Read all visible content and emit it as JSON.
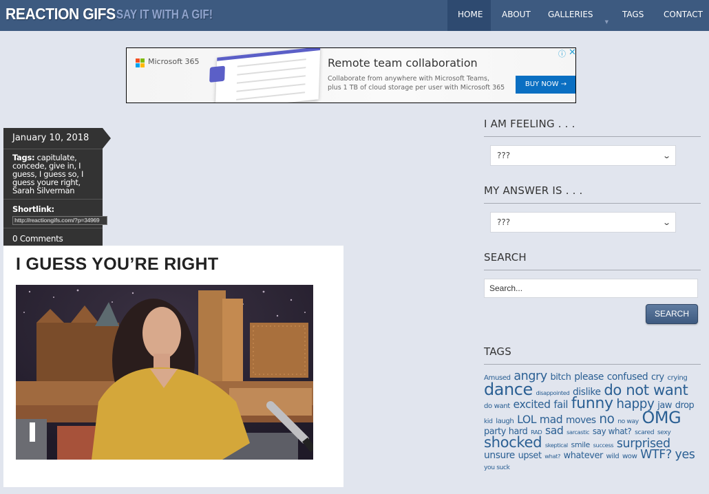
{
  "header": {
    "logo": "REACTION GIFS",
    "tagline": "SAY IT WITH A GIF!",
    "nav": [
      {
        "label": "HOME",
        "active": true
      },
      {
        "label": "ABOUT"
      },
      {
        "label": "GALLERIES",
        "has_dropdown": true
      },
      {
        "label": "TAGS"
      },
      {
        "label": "CONTACT"
      }
    ],
    "colors": {
      "bar": "#3d5a80",
      "active": "#2e4a70"
    }
  },
  "ad": {
    "brand": "Microsoft 365",
    "title": "Remote team collaboration",
    "desc_line1": "Collaborate from anywhere with Microsoft Teams,",
    "desc_line2": "plus 1 TB of cloud storage per user with Microsoft 365",
    "button": "BUY NOW →",
    "info_icon": "ⓘ",
    "close_icon": "✕"
  },
  "post": {
    "date": "January 10, 2018",
    "tags_label": "Tags:",
    "tags": "capitulate, concede, give in, I guess, I guess so, I guess youre right, Sarah Silverman",
    "shortlink_label": "Shortlink:",
    "shortlink": "http://reactiongifs.com/?p=34969",
    "comments": "0 Comments",
    "title": "I GUESS YOU’RE RIGHT"
  },
  "sidebar": {
    "feeling": {
      "heading": "I AM FEELING . . .",
      "selected": "???"
    },
    "answer": {
      "heading": "MY ANSWER IS . . .",
      "selected": "???"
    },
    "search": {
      "heading": "SEARCH",
      "placeholder": "Search...",
      "button": "SEARCH"
    },
    "tags": {
      "heading": "TAGS",
      "cloud": [
        {
          "t": "Amused",
          "s": 11
        },
        {
          "t": "angry",
          "s": 19
        },
        {
          "t": "bitch",
          "s": 14
        },
        {
          "t": "please",
          "s": 15
        },
        {
          "t": "confused",
          "s": 15
        },
        {
          "t": "cry",
          "s": 14
        },
        {
          "t": "crying",
          "s": 11
        },
        {
          "t": "dance",
          "s": 26
        },
        {
          "t": "disappointed",
          "s": 9
        },
        {
          "t": "dislike",
          "s": 15
        },
        {
          "t": "do not want",
          "s": 23
        },
        {
          "t": "do want",
          "s": 11
        },
        {
          "t": "excited",
          "s": 17
        },
        {
          "t": "fail",
          "s": 16
        },
        {
          "t": "funny",
          "s": 24
        },
        {
          "t": "happy",
          "s": 20
        },
        {
          "t": "jaw",
          "s": 14
        },
        {
          "t": "drop",
          "s": 14
        },
        {
          "t": "kid",
          "s": 10
        },
        {
          "t": "laugh",
          "s": 11
        },
        {
          "t": "LOL",
          "s": 17
        },
        {
          "t": "mad",
          "s": 17
        },
        {
          "t": "moves",
          "s": 15
        },
        {
          "t": "no",
          "s": 20
        },
        {
          "t": "no way",
          "s": 10
        },
        {
          "t": "OMG",
          "s": 26
        },
        {
          "t": "party hard",
          "s": 14
        },
        {
          "t": "RAD",
          "s": 9
        },
        {
          "t": "sad",
          "s": 17
        },
        {
          "t": "sarcastic",
          "s": 9
        },
        {
          "t": "say what?",
          "s": 13
        },
        {
          "t": "scared",
          "s": 10
        },
        {
          "t": "sexy",
          "s": 10
        },
        {
          "t": "shocked",
          "s": 23
        },
        {
          "t": "skeptical",
          "s": 9
        },
        {
          "t": "smile",
          "s": 12
        },
        {
          "t": "success",
          "s": 9
        },
        {
          "t": "surprised",
          "s": 19
        },
        {
          "t": "unsure",
          "s": 15
        },
        {
          "t": "upset",
          "s": 14
        },
        {
          "t": "what?",
          "s": 9
        },
        {
          "t": "whatever",
          "s": 14
        },
        {
          "t": "wild",
          "s": 11
        },
        {
          "t": "wow",
          "s": 11
        },
        {
          "t": "WTF?",
          "s": 19
        },
        {
          "t": "yes",
          "s": 19
        },
        {
          "t": "you suck",
          "s": 10
        }
      ]
    }
  }
}
